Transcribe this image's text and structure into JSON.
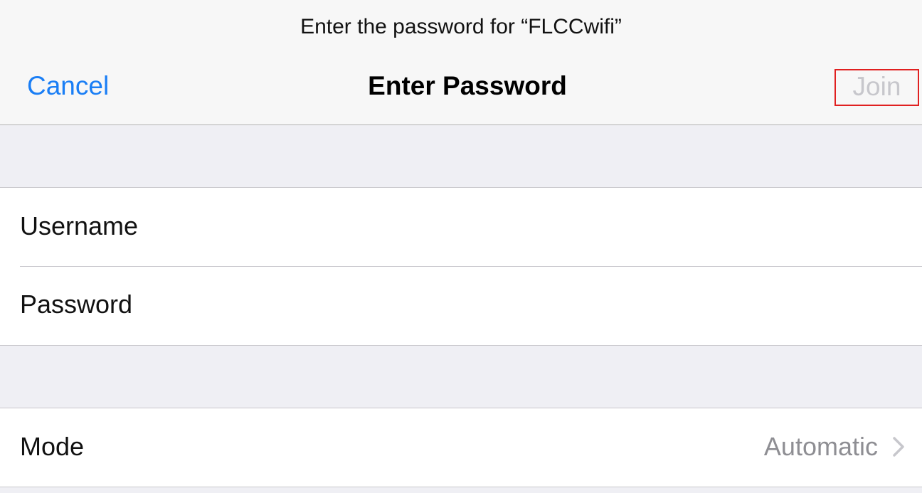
{
  "header": {
    "prompt": "Enter the password for “FLCCwifi”",
    "title": "Enter Password",
    "cancel_label": "Cancel",
    "join_label": "Join"
  },
  "credentials": {
    "username_label": "Username",
    "username_value": "",
    "password_label": "Password",
    "password_value": ""
  },
  "options": {
    "mode_label": "Mode",
    "mode_value": "Automatic",
    "chevron_icon": "chevron-right-icon"
  },
  "colors": {
    "accent": "#1a7ef5",
    "disabled": "#c7c7cc",
    "highlight_border": "#e02020"
  }
}
